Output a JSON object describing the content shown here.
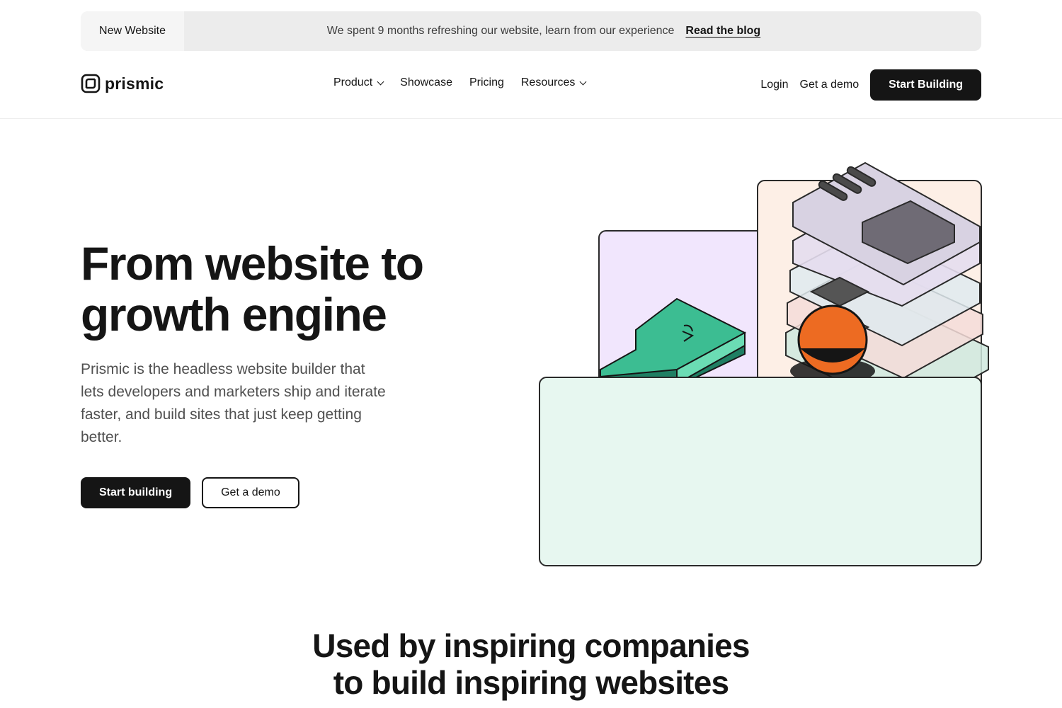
{
  "announcement": {
    "tag": "New Website",
    "message": "We spent 9 months refreshing our website, learn from our experience",
    "link": "Read the blog"
  },
  "nav": {
    "logo": "prismic",
    "logo_icon": "prismic-logo-icon",
    "links": [
      {
        "label": "Product",
        "has_dropdown": true
      },
      {
        "label": "Showcase",
        "has_dropdown": false
      },
      {
        "label": "Pricing",
        "has_dropdown": false
      },
      {
        "label": "Resources",
        "has_dropdown": true
      }
    ],
    "login": "Login",
    "demo": "Get a demo",
    "cta": "Start Building"
  },
  "hero": {
    "title_line1": "From website to",
    "title_line2": "growth engine",
    "subtitle": "Prismic is the headless website builder that lets developers and marketers ship and iterate faster, and build sites that just keep getting better.",
    "primary_cta": "Start building",
    "secondary_cta": "Get a demo"
  },
  "colors": {
    "dark": "#151515",
    "lavender": "#f1e6fd",
    "peach": "#fdefe6",
    "mint": "#e7f7f0",
    "green": "#3cbd92",
    "orange": "#ed6b22"
  },
  "companies": {
    "title_line1": "Used by inspiring companies",
    "title_line2": "to build inspiring websites"
  }
}
